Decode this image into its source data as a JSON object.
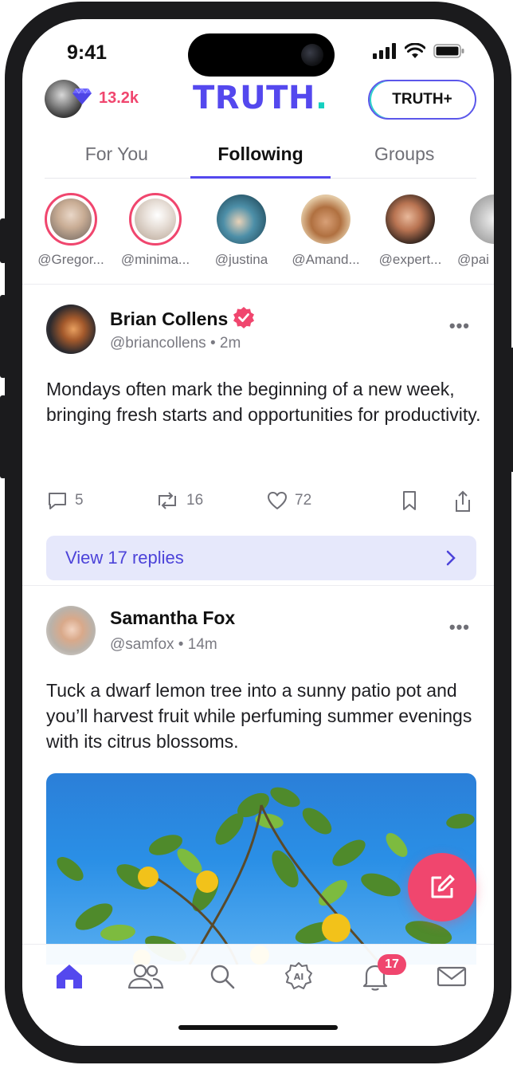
{
  "status_bar": {
    "time": "9:41"
  },
  "header": {
    "points": "13.2k",
    "logo": "TRUTH",
    "logo_dot": ".",
    "plus_button": "TRUTH+"
  },
  "tabs": [
    {
      "label": "For You",
      "active": false
    },
    {
      "label": "Following",
      "active": true
    },
    {
      "label": "Groups",
      "active": false
    }
  ],
  "stories": [
    {
      "handle": "@Gregor..."
    },
    {
      "handle": "@minima..."
    },
    {
      "handle": "@justina"
    },
    {
      "handle": "@Amand..."
    },
    {
      "handle": "@expert..."
    },
    {
      "handle": "@pai"
    }
  ],
  "posts": [
    {
      "name": "Brian Collens",
      "handle": "@briancollens",
      "time": "2m",
      "text": "Mondays often mark the beginning of a new week, bringing fresh starts and opportunities for productivity.",
      "comments": "5",
      "retruths": "16",
      "likes": "72",
      "replies_label": "View 17 replies"
    },
    {
      "name": "Samantha Fox",
      "handle": "@samfox",
      "time": "14m",
      "text": "Tuck a dwarf lemon tree into a sunny patio pot and you’ll harvest fruit while perfuming summer evenings with its citrus blossoms."
    }
  ],
  "bottom_nav": {
    "items": [
      "home-icon",
      "people-icon",
      "search-icon",
      "ai-icon",
      "bell-icon",
      "mail-icon"
    ],
    "notification_count": "17"
  },
  "colors": {
    "accent": "#5448ee",
    "brand_pink": "#f0466e",
    "teal": "#14d0c0"
  }
}
